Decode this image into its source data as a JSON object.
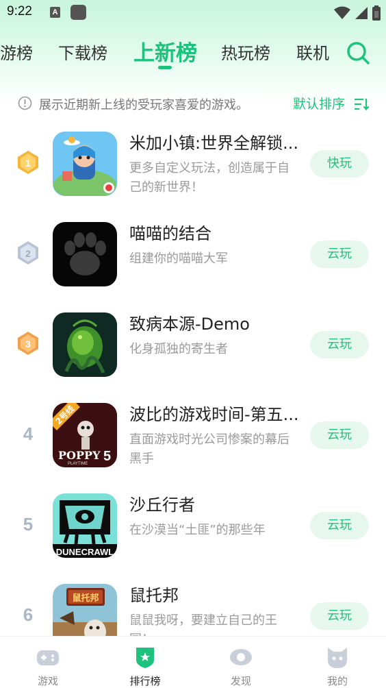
{
  "status": {
    "time": "9:22",
    "notif_letter": "A"
  },
  "tabs": [
    {
      "label": "游榜",
      "active": false
    },
    {
      "label": "下载榜",
      "active": false
    },
    {
      "label": "上新榜",
      "active": true
    },
    {
      "label": "热玩榜",
      "active": false
    },
    {
      "label": "联机",
      "active": false
    }
  ],
  "hint": {
    "text": "展示近期新上线的受玩家喜爱的游戏。",
    "sort_label": "默认排序"
  },
  "games": [
    {
      "rank": "1",
      "title": "米加小镇:世界全解锁...",
      "desc": "更多自定义玩法，创造属于自己的新世界！",
      "button": "快玩",
      "icon": "miga-town-icon"
    },
    {
      "rank": "2",
      "title": "喵喵的结合",
      "desc": "组建你的喵喵大军",
      "button": "云玩",
      "icon": "cat-paw-icon"
    },
    {
      "rank": "3",
      "title": "致病本源-Demo",
      "desc": "化身孤独的寄生者",
      "button": "云玩",
      "icon": "parasite-icon"
    },
    {
      "rank": "4",
      "title": "波比的游戏时间-第五...",
      "desc": "直面游戏时光公司惨案的幕后黑手",
      "button": "云玩",
      "icon": "poppy-playtime-icon",
      "icon_badge": "2号线",
      "icon_logo": "POPPY",
      "icon_logo_num": "5",
      "icon_logo_sub": "PLAYTIME"
    },
    {
      "rank": "5",
      "title": "沙丘行者",
      "desc": "在沙漠当“土匪”的那些年",
      "button": "云玩",
      "icon": "dunecrawl-icon",
      "icon_logo": "DUNECRAWL"
    },
    {
      "rank": "6",
      "title": "鼠托邦",
      "desc": "鼠鼠我呀，要建立自己的王国！",
      "button": "云玩",
      "icon": "ratopia-icon",
      "icon_logo": "鼠托邦"
    }
  ],
  "bottom_nav": [
    {
      "label": "游戏",
      "active": false
    },
    {
      "label": "排行榜",
      "active": true
    },
    {
      "label": "发现",
      "active": false
    },
    {
      "label": "我的",
      "active": false
    }
  ],
  "colors": {
    "accent": "#1ec27c",
    "gold": "#f5b53a",
    "silver": "#b8c4d6",
    "bronze": "#f2a04a"
  }
}
